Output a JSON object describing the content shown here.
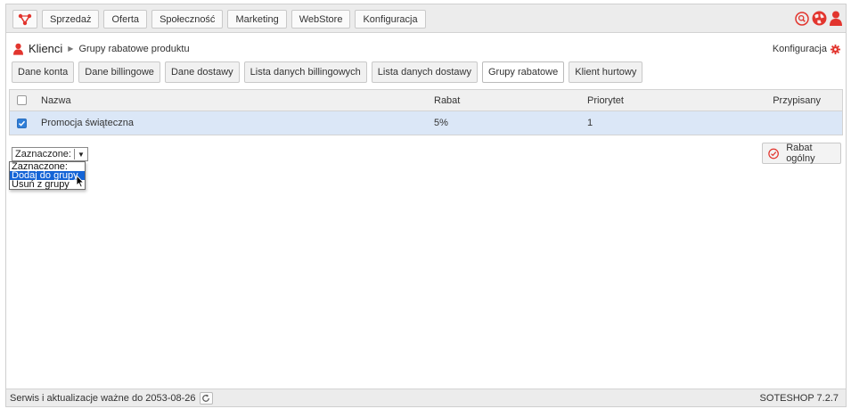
{
  "nav": {
    "items": [
      "Sprzedaż",
      "Oferta",
      "Społeczność",
      "Marketing",
      "WebStore",
      "Konfiguracja"
    ]
  },
  "breadcrumb": {
    "main": "Klienci",
    "sub": "Grupy rabatowe produktu"
  },
  "config_link": "Konfiguracja",
  "tabs": [
    {
      "label": "Dane konta"
    },
    {
      "label": "Dane billingowe"
    },
    {
      "label": "Dane dostawy"
    },
    {
      "label": "Lista danych billingowych"
    },
    {
      "label": "Lista danych dostawy"
    },
    {
      "label": "Grupy rabatowe"
    },
    {
      "label": "Klient hurtowy"
    }
  ],
  "active_tab": "Grupy rabatowe",
  "table": {
    "headers": {
      "name": "Nazwa",
      "rabat": "Rabat",
      "priority": "Priorytet",
      "assigned": "Przypisany"
    },
    "rows": [
      {
        "name": "Promocja świąteczna",
        "rabat": "5%",
        "priority": "1",
        "assigned": "",
        "checked": true
      }
    ]
  },
  "selection": {
    "value": "Zaznaczone:",
    "options": [
      "Zaznaczone:",
      "Dodaj do grupy",
      "Usuń z grupy"
    ],
    "highlighted": "Dodaj do grupy"
  },
  "rabat_button": "Rabat ogólny",
  "footer": {
    "service_text": "Serwis i aktualizacje ważne do 2053-08-26",
    "version": "SOTESHOP 7.2.7"
  },
  "colors": {
    "accent": "#e2352e",
    "row_selected": "#dbe7f7",
    "option_highlight": "#1464d6",
    "checkbox": "#2f7ed8"
  },
  "icons": {
    "logo": "logo-icon",
    "search": "search-icon",
    "globe": "globe-icon",
    "user": "user-icon",
    "gear": "gear-icon",
    "rabat": "check-circle-icon",
    "refresh": "refresh-icon",
    "cursor": "mouse-pointer-icon"
  }
}
